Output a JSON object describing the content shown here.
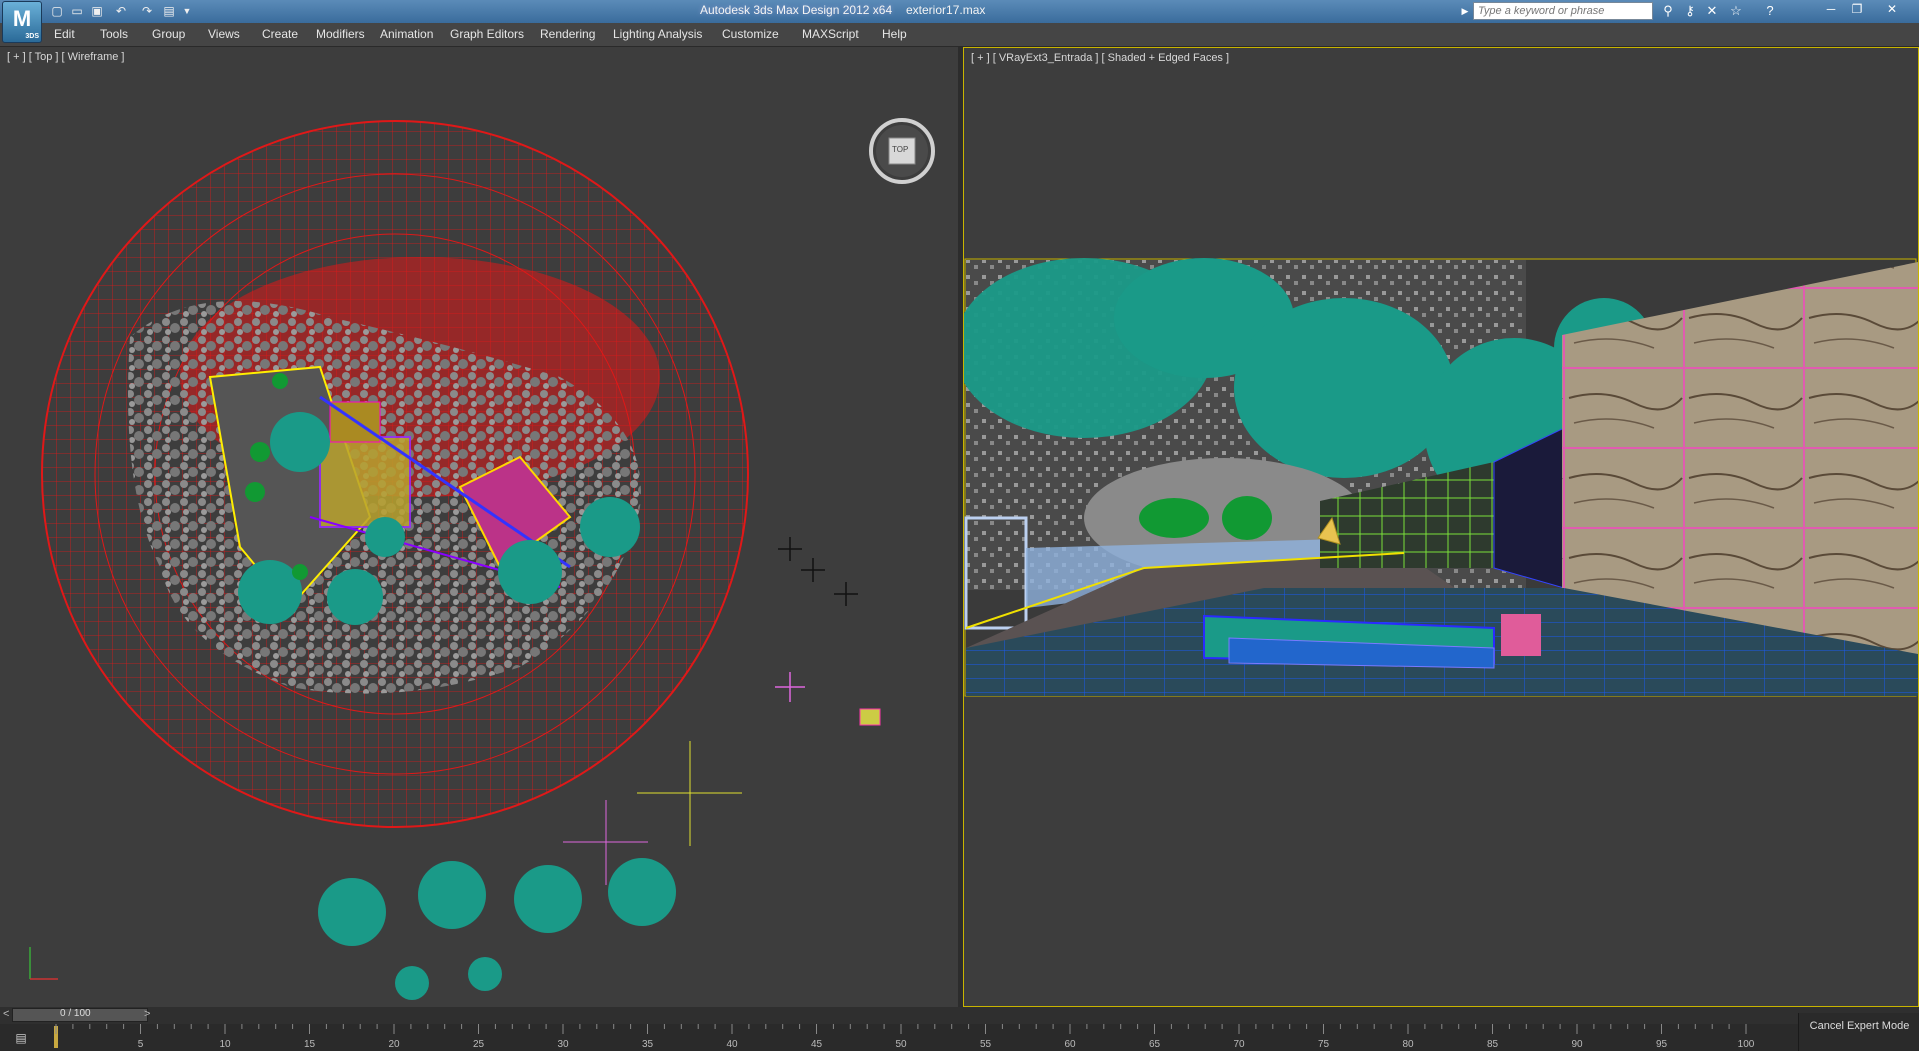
{
  "titlebar": {
    "app_logo": "3DS",
    "title": "Autodesk 3ds Max Design 2012 x64",
    "file": "exterior17.max",
    "search_placeholder": "Type a keyword or phrase",
    "quick_access_icons": [
      "new-file-icon",
      "open-file-icon",
      "save-icon",
      "undo-icon",
      "redo-icon",
      "project-folder-icon"
    ],
    "info_icons": [
      "binoculars-icon",
      "key-tools-icon",
      "communication-center-icon",
      "favorites-star-icon",
      "help-icon"
    ],
    "window_controls": [
      "minimize-icon",
      "restore-icon",
      "close-icon"
    ]
  },
  "menubar": {
    "items": [
      "Edit",
      "Tools",
      "Group",
      "Views",
      "Create",
      "Modifiers",
      "Animation",
      "Graph Editors",
      "Rendering",
      "Lighting Analysis",
      "Customize",
      "MAXScript",
      "Help"
    ]
  },
  "viewports": {
    "left": {
      "label": "[ + ] [ Top ] [ Wireframe ]",
      "viewcube_label": "TOP"
    },
    "right": {
      "label": "[ + ] [ VRayExt3_Entrada ] [ Shaded + Edged Faces ]"
    }
  },
  "timeline": {
    "frame_display": "0 / 100",
    "prev_arrow": "<",
    "next_arrow": ">",
    "ticks": [
      "5",
      "10",
      "15",
      "20",
      "25",
      "30",
      "35",
      "40",
      "45",
      "50",
      "55",
      "60",
      "65",
      "70",
      "75",
      "80",
      "85",
      "90",
      "95",
      "100"
    ]
  },
  "status": {
    "cancel_expert_mode": "Cancel Expert Mode"
  },
  "colors": {
    "wire_red": "#e01818",
    "teal_trees": "#1a9a88",
    "grey_foliage": "#8a8a8a",
    "viewport_bg": "#3d3d3d",
    "active_border": "#c8b400",
    "brick_pink": "#e05cb0"
  }
}
